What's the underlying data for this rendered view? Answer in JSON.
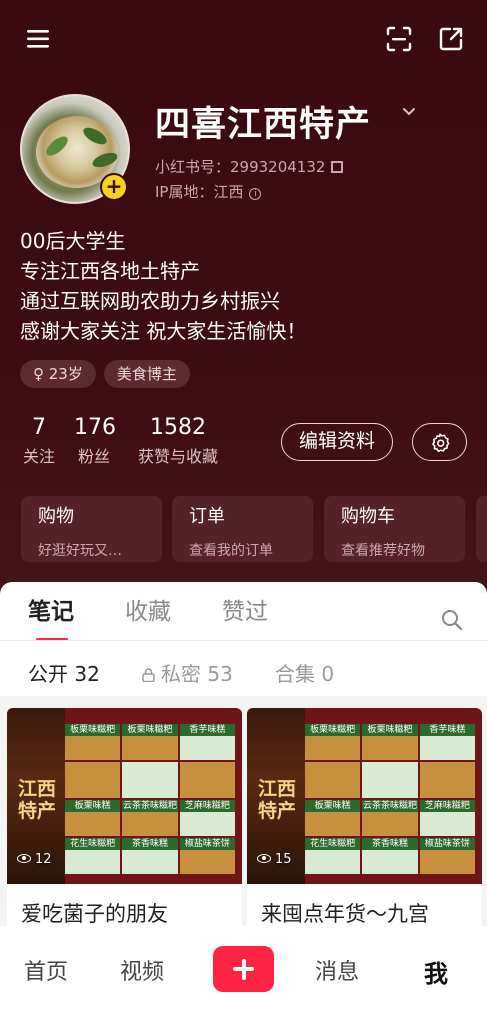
{
  "topbar": {
    "menu_icon": "menu-icon",
    "scan_icon": "scan-icon",
    "share_icon": "share-icon"
  },
  "profile": {
    "name": "四喜江西特产",
    "account_id": "小红书号：2993204132",
    "ip_location": "IP属地：江西",
    "bio": [
      "00后大学生",
      "专注江西各地土特产",
      "通过互联网助农助力乡村振兴",
      "感谢大家关注 祝大家生活愉快！"
    ],
    "tags": [
      "♀ 23岁",
      "美食博主"
    ],
    "stats": [
      {
        "num": "7",
        "label": "关注"
      },
      {
        "num": "176",
        "label": "粉丝"
      },
      {
        "num": "1582",
        "label": "获赞与收藏"
      }
    ],
    "edit_label": "编辑资料"
  },
  "service_cards": [
    {
      "title": "购物",
      "subtitle": "好逛好玩又…"
    },
    {
      "title": "订单",
      "subtitle": "查看我的订单"
    },
    {
      "title": "购物车",
      "subtitle": "查看推荐好物"
    }
  ],
  "content_tabs": [
    "笔记",
    "收藏",
    "赞过"
  ],
  "sub_tabs": [
    "公开 32",
    "私密 53",
    "合集 0"
  ],
  "notes": [
    {
      "poster_text": "江西特产",
      "views": "12",
      "title": "爱吃菌子的朋友"
    },
    {
      "poster_text": "江西特产",
      "views": "15",
      "title": "来囤点年货～九宫"
    }
  ],
  "poster_cells": [
    "板栗味糍粑",
    "板栗味糍粑",
    "香芋味糕",
    "",
    "",
    "",
    "板栗味糕",
    "云茶茶味糍粑",
    "芝麻味糍粑",
    "花生味糍粑",
    "茶香味糕",
    "椒盐味茶饼"
  ],
  "bottom_nav": [
    "首页",
    "视频",
    "消息",
    "我"
  ],
  "colors": {
    "accent": "#ff2442",
    "profile_bg": "#3b0a10",
    "badge": "#f5d21b"
  }
}
